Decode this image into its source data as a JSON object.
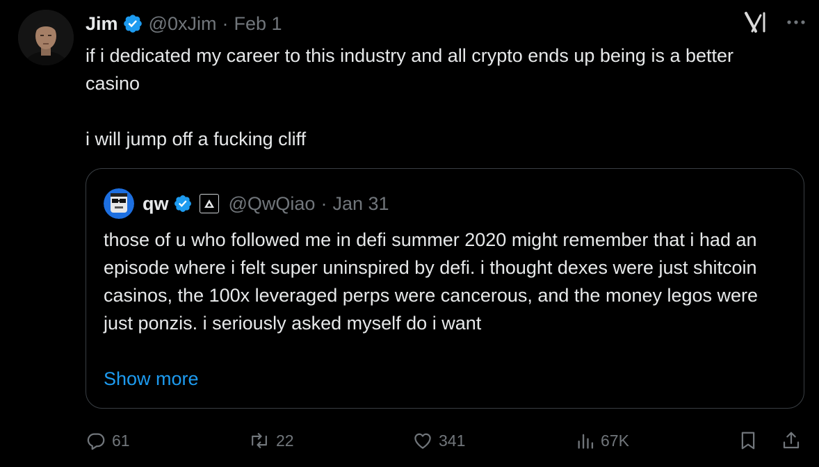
{
  "tweet": {
    "author": {
      "display_name": "Jim",
      "handle": "@0xJim",
      "verified": true
    },
    "separator": "·",
    "date": "Feb 1",
    "text_lines": [
      "if i dedicated my career to this industry and all crypto ends up being is a better casino",
      "i will jump off a fucking cliff"
    ],
    "quoted": {
      "author": {
        "display_name": "qw",
        "handle": "@QwQiao",
        "verified": true
      },
      "separator": "·",
      "date": "Jan 31",
      "text": "those of u who followed me in defi summer 2020 might remember that i had an episode where i felt super uninspired by defi. i thought dexes were just shitcoin casinos, the 100x leveraged perps were cancerous, and the money legos were just ponzis. i seriously asked myself do i want",
      "show_more_label": "Show more"
    },
    "actions": {
      "replies": "61",
      "reposts": "22",
      "likes": "341",
      "views": "67K"
    }
  },
  "icons": {
    "header": [
      "verified-badge-icon",
      "x-logo-icon",
      "more-icon"
    ],
    "actions": [
      "reply-icon",
      "repost-icon",
      "like-icon",
      "views-icon",
      "bookmark-icon",
      "share-icon"
    ]
  },
  "colors": {
    "background": "#000000",
    "text_primary": "#e7e9ea",
    "text_secondary": "#71767b",
    "accent_blue": "#1d9bf0",
    "border": "#3a3f44"
  }
}
